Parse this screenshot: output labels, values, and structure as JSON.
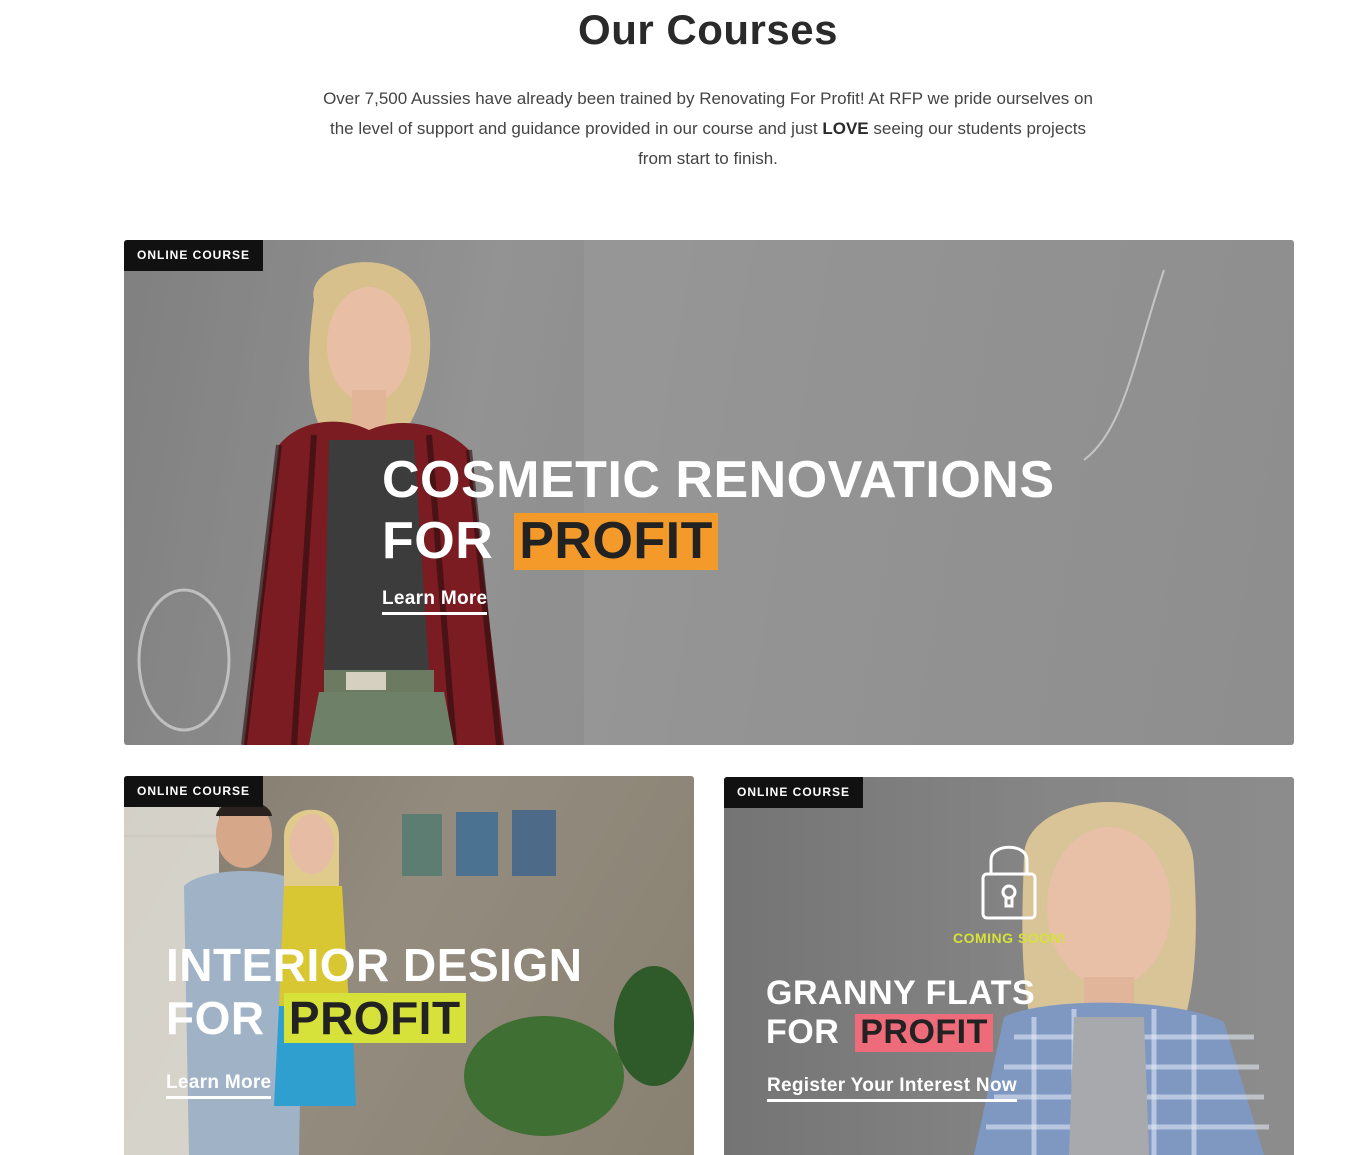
{
  "section": {
    "title": "Our Courses",
    "intro_part1": "Over 7,500 Aussies have already been trained by Renovating For Profit! At RFP we pride ourselves on the level of support and guidance provided in our course and just ",
    "intro_bold": "LOVE",
    "intro_part2": " seeing our students projects from start to finish."
  },
  "courses": [
    {
      "badge": "ONLINE COURSE",
      "title_line1": "COSMETIC RENOVATIONS",
      "title_for": "FOR",
      "title_highlight": "PROFIT",
      "highlight_color": "#f39a2b",
      "cta": "Learn More"
    },
    {
      "badge": "ONLINE COURSE",
      "title_line1": "INTERIOR DESIGN",
      "title_for": "FOR",
      "title_highlight": "PROFIT",
      "highlight_color": "#d6e23a",
      "cta": "Learn More"
    },
    {
      "badge": "ONLINE COURSE",
      "status": "COMING SOON!",
      "status_color": "#d6e23a",
      "lock_icon": "padlock-icon",
      "title_line1": "GRANNY FLATS",
      "title_for": "FOR",
      "title_highlight": "PROFIT",
      "highlight_color": "#ee6b7a",
      "cta": "Register Your Interest Now"
    }
  ]
}
